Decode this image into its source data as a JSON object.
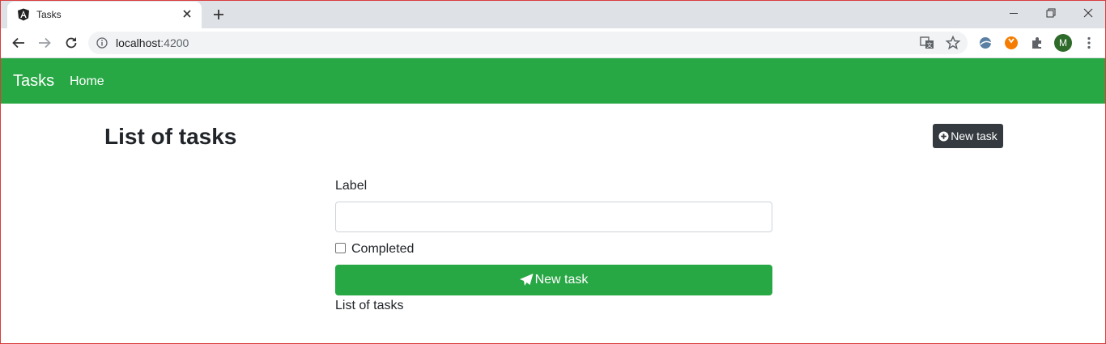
{
  "browser": {
    "tab_title": "Tasks",
    "url_host": "localhost",
    "url_port": ":4200",
    "profile_initial": "M"
  },
  "navbar": {
    "brand": "Tasks",
    "home_link": "Home"
  },
  "page": {
    "title": "List of tasks",
    "new_task_button": "New task"
  },
  "form": {
    "label_field_label": "Label",
    "label_field_value": "",
    "completed_label": "Completed",
    "completed_checked": false,
    "submit_label": "New task"
  },
  "list": {
    "caption": "List of tasks"
  },
  "colors": {
    "navbar": "#28a745",
    "dark_button": "#343a40",
    "submit_button": "#28a745"
  },
  "icons": {
    "favicon": "angular-icon",
    "dark_button": "plus-circle-icon",
    "submit_button": "paper-plane-icon"
  }
}
